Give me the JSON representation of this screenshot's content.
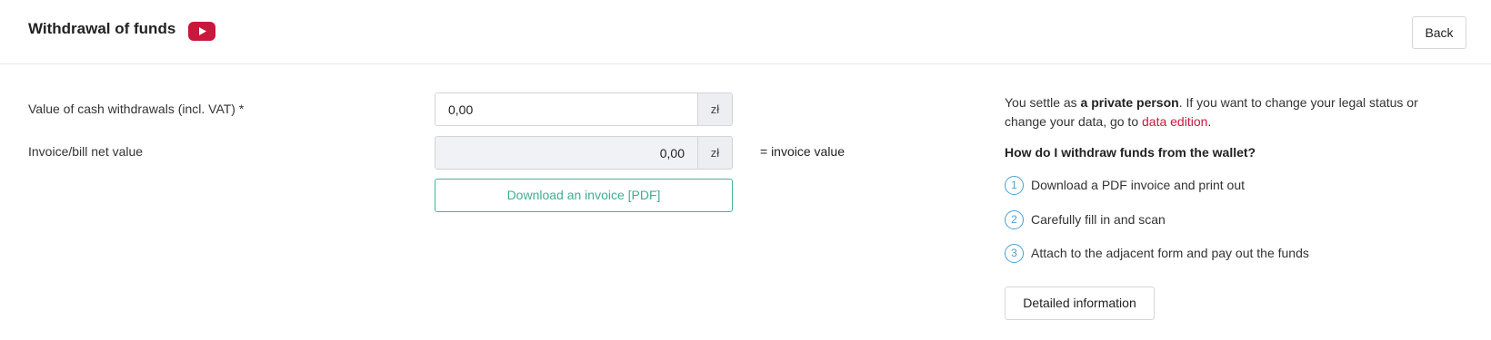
{
  "header": {
    "title": "Withdrawal of funds",
    "video_icon": "youtube-play-icon",
    "back_label": "Back"
  },
  "form": {
    "withdrawal_label": "Value of cash withdrawals (incl. VAT) *",
    "withdrawal_value": "0,00",
    "withdrawal_currency": "zł",
    "net_label": "Invoice/bill net value",
    "net_value": "0,00",
    "net_currency": "zł",
    "invoice_value_label": "= invoice value",
    "download_label": "Download an invoice [PDF]"
  },
  "info": {
    "settle_prefix": "You settle as ",
    "settle_status": "a private person",
    "settle_middle": ". If you want to change your legal status or change your data, go to ",
    "settle_link": "data edition",
    "settle_suffix": ".",
    "how_heading": "How do I withdraw funds from the wallet?",
    "steps": [
      {
        "num": "1",
        "text": "Download a PDF invoice and print out"
      },
      {
        "num": "2",
        "text": "Carefully fill in and scan"
      },
      {
        "num": "3",
        "text": "Attach to the adjacent form and pay out the funds"
      }
    ],
    "detail_label": "Detailed information"
  },
  "colors": {
    "brand_red": "#c8183c",
    "accent_green": "#45b39a",
    "step_blue": "#4a9fd8"
  }
}
